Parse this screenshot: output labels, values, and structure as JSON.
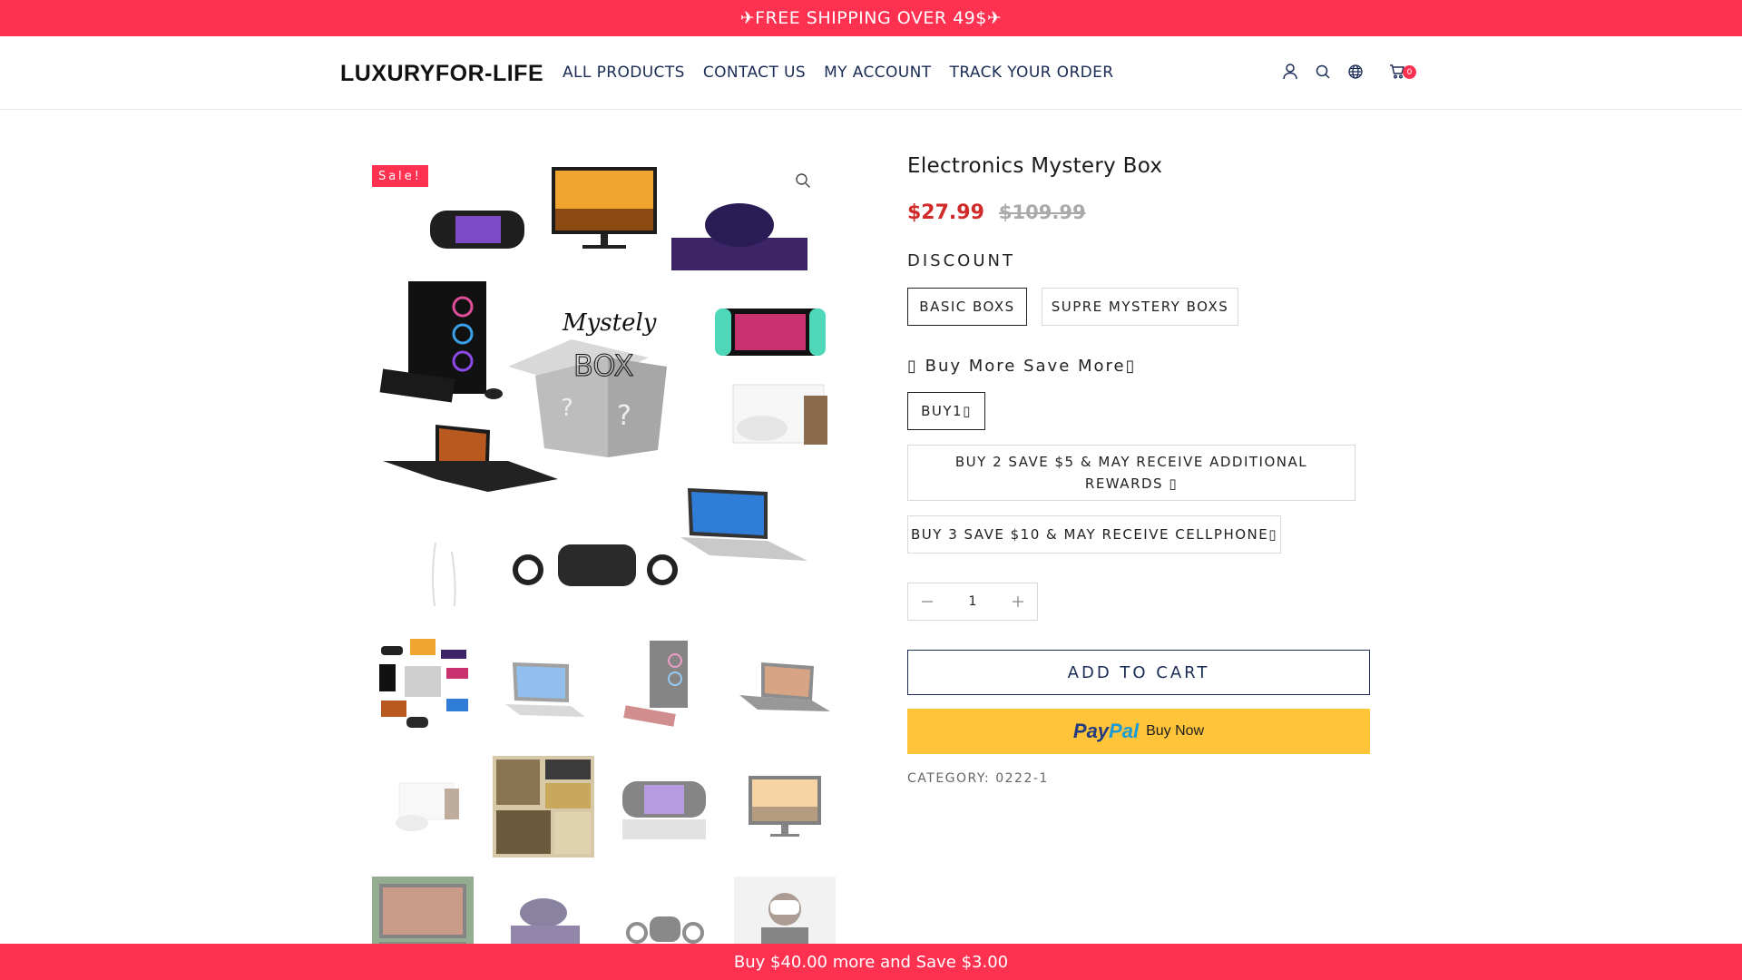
{
  "announcement": {
    "text": "✈FREE SHIPPING OVER 49$✈"
  },
  "header": {
    "logo": "LUXURYFOR-LIFE",
    "nav": [
      "ALL PRODUCTS",
      "CONTACT US",
      "MY ACCOUNT",
      "TRACK YOUR ORDER"
    ],
    "icons": [
      "user-icon",
      "search-icon",
      "globe-icon",
      "cart-icon"
    ],
    "cart_count": "0"
  },
  "gallery": {
    "sale_badge": "Sale!",
    "zoom_icon": "magnifier-icon",
    "thumbnails": [
      "mystery-box-collage",
      "silver-laptop",
      "gaming-pc",
      "gaming-laptop",
      "vr-headset-box",
      "tools-collage",
      "handheld-console",
      "monitor",
      "laptop-with-game",
      "game-console",
      "vr-headset",
      "person-with-vr"
    ],
    "main_image_texts": [
      "Mystely",
      "BOX",
      "?",
      "?"
    ]
  },
  "product": {
    "title": "Electronics Mystery Box",
    "price": "$27.99",
    "compare_price": "$109.99",
    "discount_label": "DISCOUNT",
    "discount_options": [
      "BASIC BOXS",
      "SUPRE MYSTERY BOXS"
    ],
    "discount_selected": "BASIC BOXS",
    "bundle_label": "▯ Buy More Save More▯",
    "bundle_options": [
      "BUY1▯",
      "BUY 2 SAVE $5 & MAY RECEIVE ADDITIONAL REWARDS ▯",
      "BUY 3 SAVE $10 & MAY RECEIVE CELLPHONE▯"
    ],
    "bundle_selected": "BUY1▯",
    "quantity": "1",
    "add_to_cart": "ADD TO CART",
    "paypal_brand_a": "Pay",
    "paypal_brand_b": "Pal",
    "paypal_text": "Buy Now",
    "category": "CATEGORY: 0222-1"
  },
  "bottom_bar": {
    "text": "Buy $40.00 more and Save $3.00"
  },
  "colors": {
    "accent": "#ff3151",
    "nav": "#1a2b55",
    "price": "#d12a2a",
    "paypal": "#ffc439"
  }
}
